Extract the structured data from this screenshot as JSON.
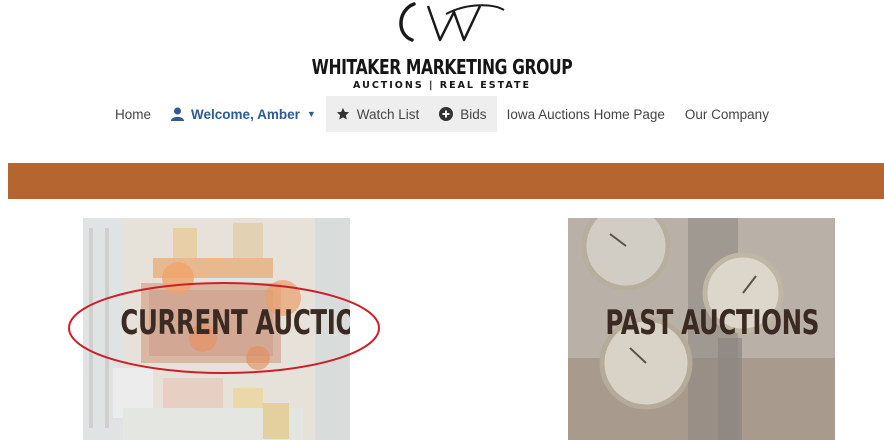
{
  "brand": {
    "name": "WHITAKER MARKETING GROUP",
    "tagline": "AUCTIONS | REAL ESTATE",
    "logo_icon": "w-monogram-logo"
  },
  "nav": {
    "items": [
      {
        "label": "Home"
      },
      {
        "label": "Welcome, Amber",
        "icon": "user-icon",
        "has_dropdown": true
      },
      {
        "label": "Watch List",
        "icon": "star-icon"
      },
      {
        "label": "Bids",
        "icon": "plus-circle-icon"
      },
      {
        "label": "Iowa Auctions Home Page"
      },
      {
        "label": "Our Company"
      }
    ]
  },
  "colors": {
    "accent_band": "#b5652f",
    "user_link": "#2b5c92",
    "annotation": "#cc1f2a"
  },
  "tiles": [
    {
      "label": "CURRENT AUCTIONS"
    },
    {
      "label": "PAST AUCTIONS"
    }
  ]
}
